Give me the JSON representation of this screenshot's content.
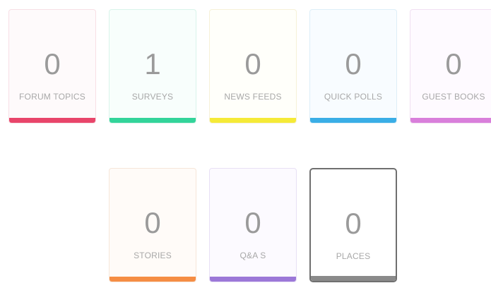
{
  "cards": [
    {
      "label": "FORUM TOPICS",
      "count": "0",
      "accent": "#e8456a",
      "tint": "#fefafb",
      "border": "#f7dfe5"
    },
    {
      "label": "SURVEYS",
      "count": "1",
      "accent": "#33d49a",
      "tint": "#f8fefc",
      "border": "#d9f4ea"
    },
    {
      "label": "NEWS FEEDS",
      "count": "0",
      "accent": "#f5ea37",
      "tint": "#fffffa",
      "border": "#f6f1d8"
    },
    {
      "label": "QUICK POLLS",
      "count": "0",
      "accent": "#3aaee6",
      "tint": "#f8fcff",
      "border": "#ddeef8"
    },
    {
      "label": "GUEST BOOKS",
      "count": "0",
      "accent": "#d97fdb",
      "tint": "#fefaff",
      "border": "#f1dff2"
    },
    {
      "label": "STORIES",
      "count": "0",
      "accent": "#f58d44",
      "tint": "#fffbf8",
      "border": "#f6e6d9"
    },
    {
      "label": "Q&A S",
      "count": "0",
      "accent": "#9c78d8",
      "tint": "#fcfaff",
      "border": "#e8e0f5"
    },
    {
      "label": "PLACES",
      "count": "0",
      "accent": "#8a8a8a",
      "tint": "#ffffff",
      "border": "#6f6f6f"
    }
  ],
  "colors": {
    "count_text": "#9a9a9a",
    "label_text": "#a8a8a8"
  }
}
